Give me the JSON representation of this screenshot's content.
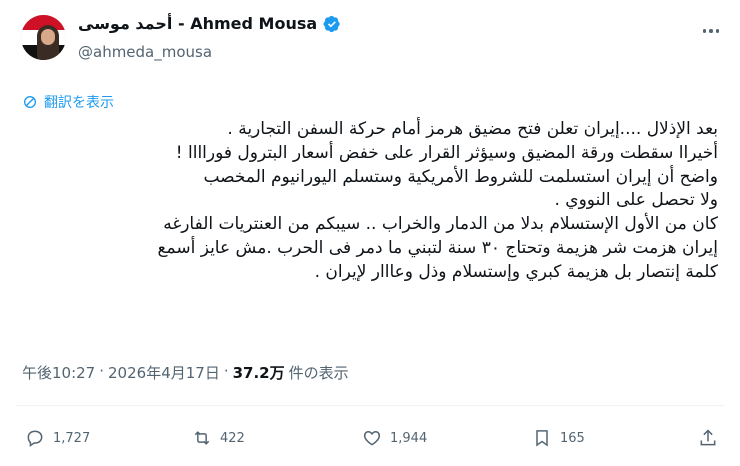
{
  "author": {
    "display_name": "أحمد موسى - Ahmed Mousa",
    "handle": "@ahmeda_mousa",
    "verified": true
  },
  "translate_label": "翻訳を表示",
  "tweet_lines": [
    "بعد الإذلال ....إيران تعلن فتح مضيق هرمز أمام حركة السفن التجارية .",
    "أخيراا سقطت ورقة المضيق وسيؤثر القرار على خفض أسعار البترول فوراااا !",
    "واضح أن إيران استسلمت للشروط الأمريكية وستسلم اليورانيوم المخصب",
    "ولا تحصل على النووي .",
    "كان من الأول الإستسلام بدلا من الدمار والخراب .. سيبكم من العنتريات الفارغه",
    "إيران هزمت شر هزيمة وتحتاج ٣٠ سنة لتبني ما دمر فى الحرب .مش عايز أسمع",
    "كلمة إنتصار بل هزيمة كبري وإستسلام وذل  وعااار لإيران ."
  ],
  "meta": {
    "time": "午後10:27",
    "separator": "·",
    "date": "2026年4月17日",
    "views_count": "37.2万",
    "views_label": "件の表示"
  },
  "actions": {
    "replies": "1,727",
    "reposts": "422",
    "likes": "1,944",
    "bookmarks": "165"
  },
  "colors": {
    "accent": "#1d9bf0",
    "secondary_text": "#536471",
    "primary_text": "#0f1419"
  },
  "icons": [
    "verified-badge-icon",
    "more-icon",
    "translate-icon",
    "reply-icon",
    "repost-icon",
    "like-icon",
    "bookmark-icon",
    "share-icon"
  ]
}
